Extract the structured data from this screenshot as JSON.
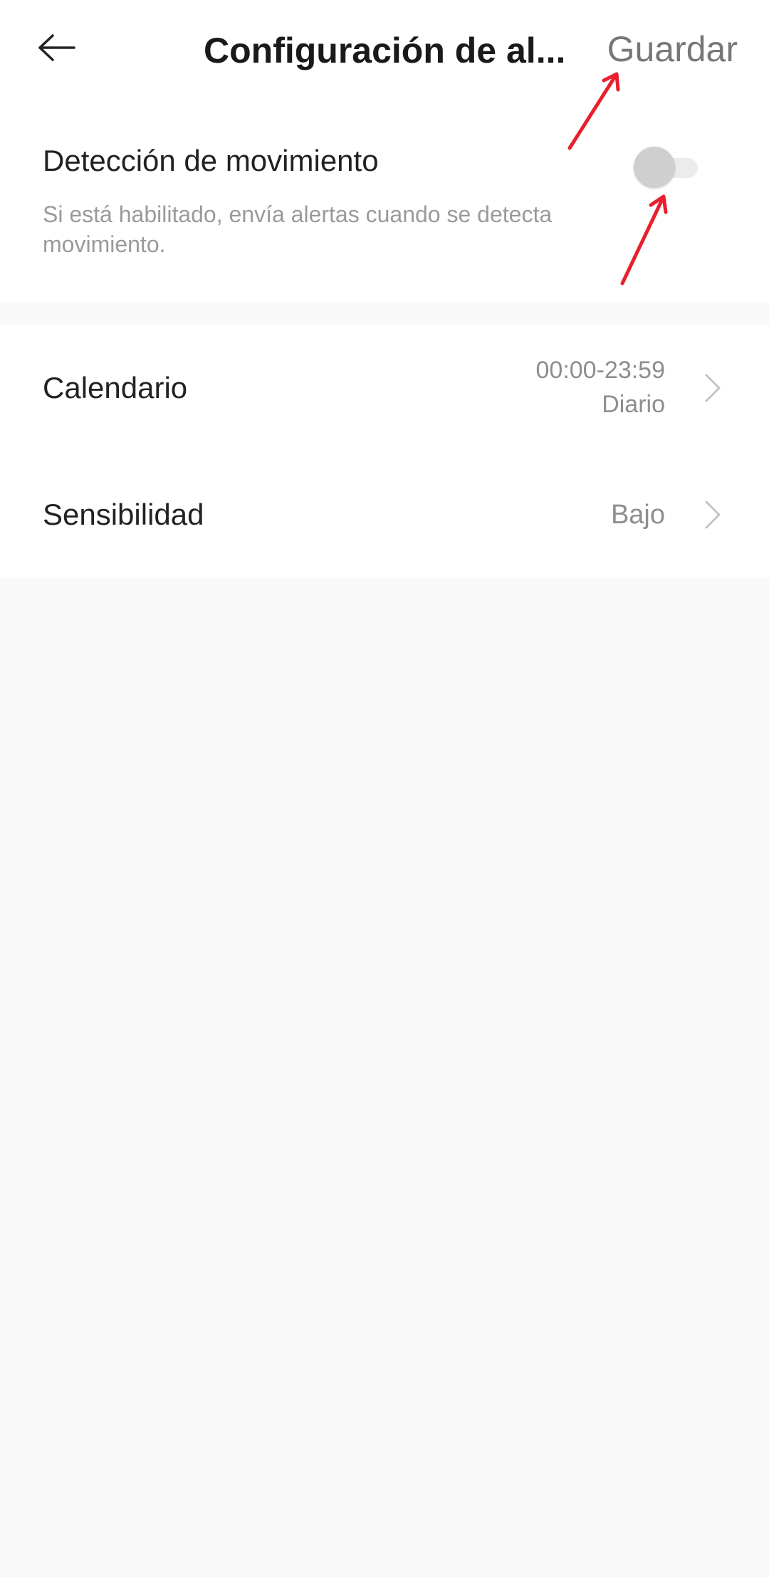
{
  "header": {
    "title": "Configuración de al...",
    "save_label": "Guardar",
    "back_icon": "arrow-left-icon"
  },
  "motion": {
    "title": "Detección de movimiento",
    "description": "Si está habilitado, envía alertas cuando se detecta movimiento.",
    "toggle_on": false
  },
  "settings": {
    "schedule": {
      "label": "Calendario",
      "time": "00:00-23:59",
      "repeat": "Diario"
    },
    "sensitivity": {
      "label": "Sensibilidad",
      "value": "Bajo"
    }
  },
  "colors": {
    "annotation": "#e8202e",
    "background": "#f9f9f9",
    "card": "#ffffff"
  }
}
